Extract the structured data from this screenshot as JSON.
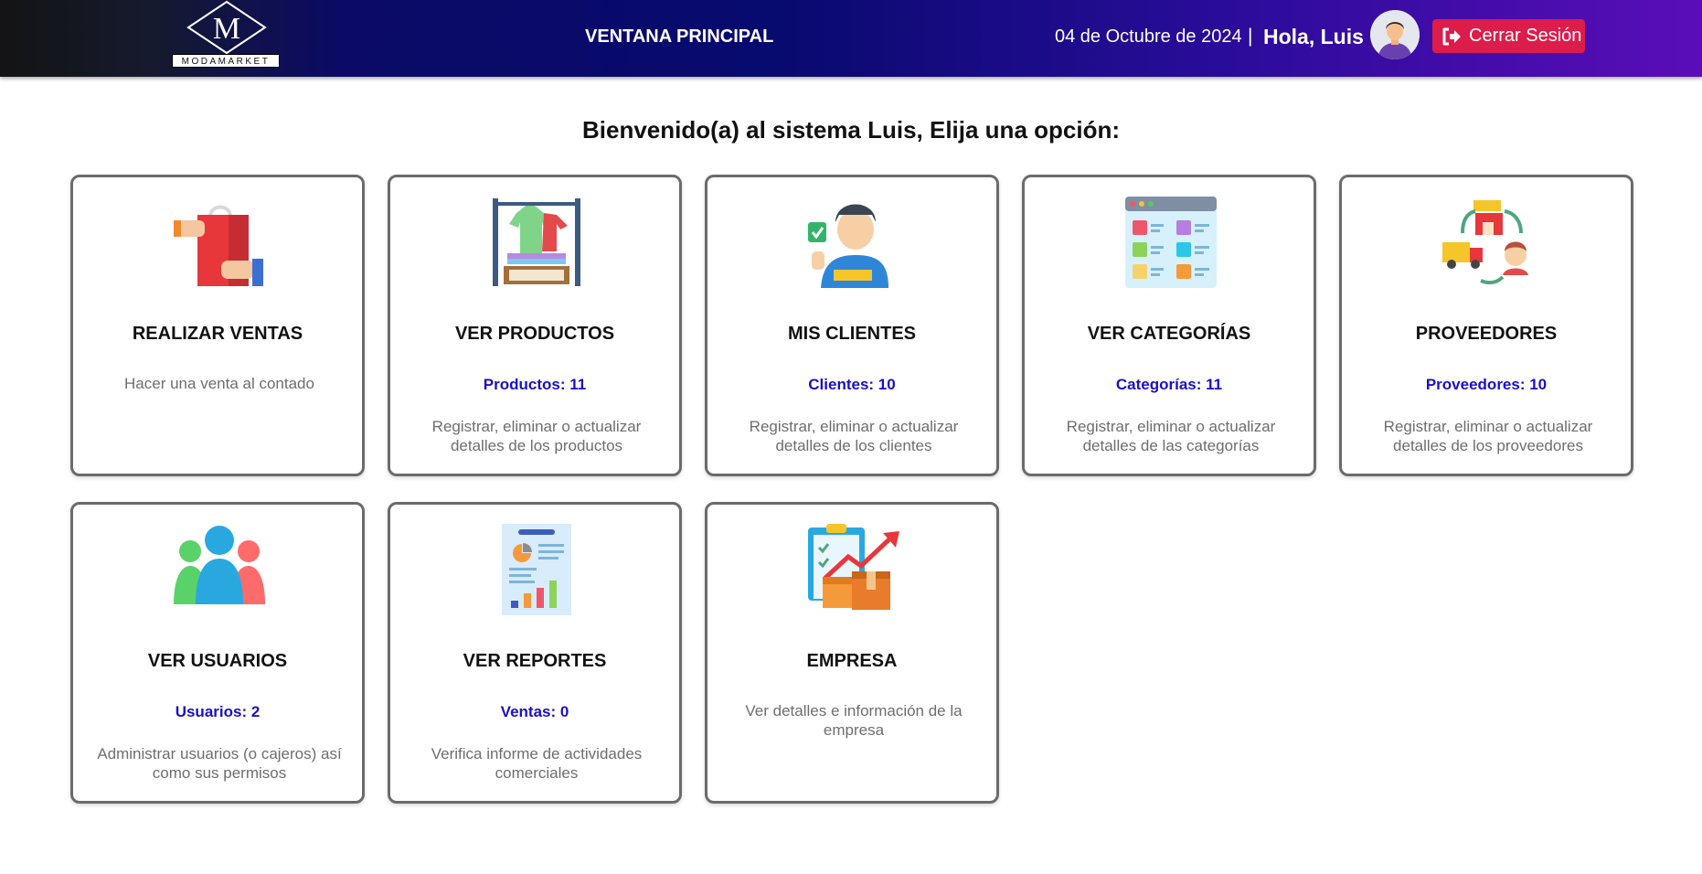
{
  "header": {
    "logo_letter": "M",
    "logo_text": "MODAMARKET",
    "window_title": "VENTANA PRINCIPAL",
    "date": "04 de Octubre de 2024",
    "separator": "|",
    "greeting": "Hola, Luis",
    "logout_label": "Cerrar Sesión",
    "logout_color": "#dc1c4a"
  },
  "welcome": "Bienvenido(a) al sistema Luis, Elija una opción:",
  "cards": [
    {
      "icon": "shopping-bag-hands-icon",
      "title": "REALIZAR VENTAS",
      "count": "",
      "description": "Hacer una venta al contado"
    },
    {
      "icon": "clothes-rack-icon",
      "title": "VER PRODUCTOS",
      "count": "Productos: 11",
      "description": "Registrar, eliminar o actualizar detalles de los productos"
    },
    {
      "icon": "customer-icon",
      "title": "MIS CLIENTES",
      "count": "Clientes: 10",
      "description": "Registrar, eliminar o actualizar detalles de los clientes"
    },
    {
      "icon": "categories-grid-icon",
      "title": "VER CATEGORÍAS",
      "count": "Categorías: 11",
      "description": "Registrar, eliminar o actualizar detalles de las categorías"
    },
    {
      "icon": "supply-chain-icon",
      "title": "PROVEEDORES",
      "count": "Proveedores: 10",
      "description": "Registrar, eliminar o actualizar detalles de los proveedores"
    },
    {
      "icon": "users-group-icon",
      "title": "VER USUARIOS",
      "count": "Usuarios: 2",
      "description": "Administrar usuarios (o cajeros) así como sus permisos"
    },
    {
      "icon": "report-document-icon",
      "title": "VER REPORTES",
      "count": "Ventas: 0",
      "description": "Verifica informe de actividades comerciales"
    },
    {
      "icon": "company-boxes-icon",
      "title": "EMPRESA",
      "count": "",
      "description": "Ver detalles e información de la empresa"
    }
  ],
  "colors": {
    "count_text": "#1a10c8",
    "card_border": "#6b6b6b"
  }
}
